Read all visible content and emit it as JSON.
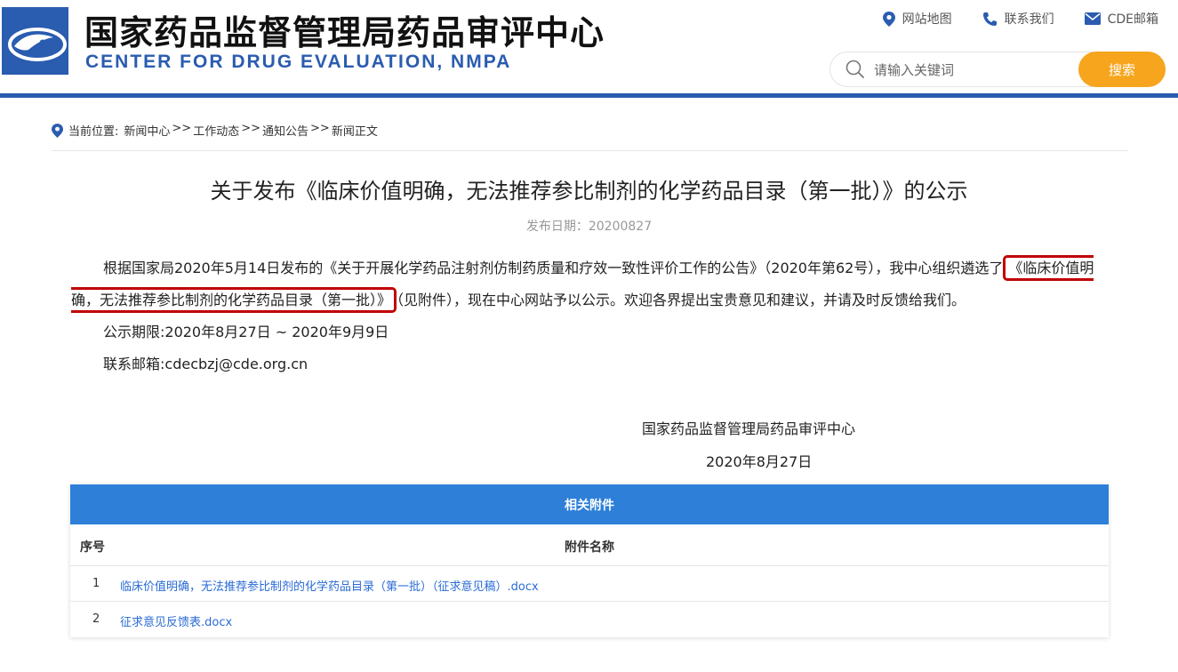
{
  "header": {
    "title_cn": "国家药品监督管理局药品审评中心",
    "title_en": "CENTER FOR DRUG EVALUATION, NMPA",
    "links": [
      {
        "label": "网站地图",
        "icon": "location-pin-icon"
      },
      {
        "label": "联系我们",
        "icon": "phone-icon"
      },
      {
        "label": "CDE邮箱",
        "icon": "mail-icon"
      }
    ],
    "search": {
      "placeholder": "请输入关键词",
      "value": "",
      "button_label": "搜索"
    },
    "accent_color": "#2a5cb0",
    "search_button_color": "#f7a51c"
  },
  "breadcrumb": {
    "prefix": "当前位置:",
    "items": [
      "新闻中心",
      ">>",
      "工作动态",
      ">>",
      "通知公告",
      ">>",
      "新闻正文"
    ]
  },
  "article": {
    "title": "关于发布《临床价值明确，无法推荐参比制剂的化学药品目录（第一批）》的公示",
    "date": "发布日期：20200827",
    "paragraph1_part1": "根据国家局2020年5月14日发布的《关于开展化学药品注射剂仿制药质量和疗效一致性评价工作的公告》（2020年第62号），我中心组织遴选了",
    "paragraph1_highlight": "《临床价值明确，无法推荐参比制剂的化学药品目录（第一批）》",
    "paragraph1_part2": "（见附件），现在中心网站予以公示。欢迎各界提出宝贵意见和建议，并请及时反馈给我们。",
    "period": "公示期限:2020年8月27日 ~ 2020年9月9日",
    "email": "联系邮箱:cdecbzj@cde.org.cn",
    "signature_org": "国家药品监督管理局药品审评中心",
    "signature_date": "2020年8月27日",
    "highlight_color": "#c00000"
  },
  "attachments": {
    "heading": "相关附件",
    "col_number": "序号",
    "col_name": "附件名称",
    "rows": [
      {
        "num": "1",
        "name": "临床价值明确，无法推荐参比制剂的化学药品目录（第一批）（征求意见稿）.docx"
      },
      {
        "num": "2",
        "name": "征求意见反馈表.docx"
      }
    ],
    "header_color": "#2d7fd8",
    "link_color": "#2a6bd6"
  }
}
